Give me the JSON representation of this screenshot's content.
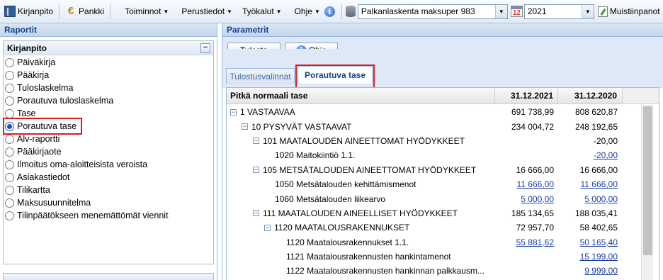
{
  "toolbar": {
    "kirjanpito": "Kirjanpito",
    "pankki": "Pankki",
    "toiminnot": "Toiminnot",
    "perustiedot": "Perustiedot",
    "tyokalut": "Työkalut",
    "ohje": "Ohje",
    "company": "Palkanlaskenta maksuper 983",
    "calendar_day": "12",
    "year": "2021",
    "muistiinpanot": "Muistiinpanot"
  },
  "left": {
    "header": "Raportit",
    "group_title": "Kirjanpito",
    "items": [
      {
        "label": "Päiväkirja",
        "selected": false
      },
      {
        "label": "Pääkirja",
        "selected": false
      },
      {
        "label": "Tuloslaskelma",
        "selected": false
      },
      {
        "label": "Porautuva tuloslaskelma",
        "selected": false
      },
      {
        "label": "Tase",
        "selected": false
      },
      {
        "label": "Porautuva tase",
        "selected": true
      },
      {
        "label": "Alv-raportti",
        "selected": false
      },
      {
        "label": "Pääkirjaote",
        "selected": false
      },
      {
        "label": "Ilmoitus oma-aloitteisista veroista",
        "selected": false
      },
      {
        "label": "Asiakastiedot",
        "selected": false
      },
      {
        "label": "Tilikartta",
        "selected": false
      },
      {
        "label": "Maksusuunnitelma",
        "selected": false
      },
      {
        "label": "Tilinpäätökseen menemättömät viennit",
        "selected": false
      }
    ]
  },
  "right": {
    "header": "Parametrit",
    "tulosta": "Tulosta",
    "ohje": "Ohje",
    "tabs": [
      "Tulostusvalinnat",
      "Porautuva tase"
    ],
    "grid": {
      "col_name": "Pitkä normaali tase",
      "col_2021": "31.12.2021",
      "col_2020": "31.12.2020",
      "rows": [
        {
          "label": "1 VASTAAVAA",
          "toggle": true,
          "v2021": "691 738,99",
          "v2020": "808 620,87",
          "link": false
        },
        {
          "label": "10 PYSYVÄT VASTAAVAT",
          "toggle": true,
          "v2021": "234 004,72",
          "v2020": "248 192,65",
          "link": false
        },
        {
          "label": "101 MAATALOUDEN AINEETTOMAT HYÖDYKKEET",
          "toggle": true,
          "v2021": "",
          "v2020": "-20,00",
          "link": false
        },
        {
          "label": "1020 Maitokiintiö 1.1.",
          "toggle": false,
          "v2021": "",
          "v2020": "-20,00",
          "link": true
        },
        {
          "label": "105 METSÄTALOUDEN AINEETTOMAT HYÖDYKKEET",
          "toggle": true,
          "v2021": "16 666,00",
          "v2020": "16 666,00",
          "link": false
        },
        {
          "label": "1050 Metsätalouden kehittämismenot",
          "toggle": false,
          "v2021": "11 666,00",
          "v2020": "11 666,00",
          "link": true
        },
        {
          "label": "1060 Metsätalouden liikearvo",
          "toggle": false,
          "v2021": "5 000,00",
          "v2020": "5 000,00",
          "link": true
        },
        {
          "label": "111 MAATALOUDEN AINEELLISET HYÖDYKKEET",
          "toggle": true,
          "v2021": "185 134,65",
          "v2020": "188 035,41",
          "link": false
        },
        {
          "label": "1120 MAATALOUSRAKENNUKSET",
          "toggle": true,
          "v2021": "72 957,70",
          "v2020": "58 402,65",
          "link": false
        },
        {
          "label": "1120 Maatalousrakennukset 1.1.",
          "toggle": false,
          "v2021": "55 881,62",
          "v2020": "50 165,40",
          "link": true
        },
        {
          "label": "1121 Maatalousrakennusten hankintamenot",
          "toggle": false,
          "v2021": "",
          "v2020": "15 199,00",
          "link": true
        },
        {
          "label": "1122 Maatalousrakennusten hankinnan palkkausm...",
          "toggle": false,
          "v2021": "",
          "v2020": "9 999,00",
          "link": true
        }
      ]
    }
  }
}
